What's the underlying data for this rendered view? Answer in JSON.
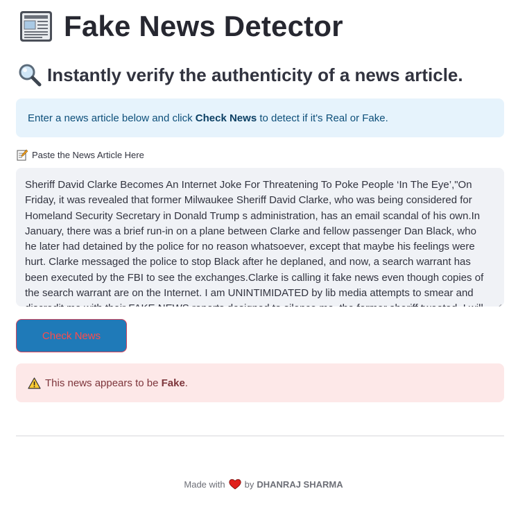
{
  "header": {
    "title": "Fake News Detector",
    "icon": "newspaper-icon"
  },
  "subheader": {
    "text": "Instantly verify the authenticity of a news article.",
    "icon": "magnifier-icon"
  },
  "info": {
    "prefix": "Enter a news article below and click ",
    "bold": "Check News",
    "suffix": " to detect if it's Real or Fake."
  },
  "input": {
    "label": "Paste the News Article Here",
    "icon": "memo-icon",
    "value": "Sheriff David Clarke Becomes An Internet Joke For Threatening To Poke People ‘In The Eye’,\"On Friday, it was revealed that former Milwaukee Sheriff David Clarke, who was being considered for Homeland Security Secretary in Donald Trump s administration, has an email scandal of his own.In January, there was a brief run-in on a plane between Clarke and fellow passenger Dan Black, who he later had detained by the police for no reason whatsoever, except that maybe his feelings were hurt. Clarke messaged the police to stop Black after he deplaned, and now, a search warrant has been executed by the FBI to see the exchanges.Clarke is calling it fake news even though copies of the search warrant are on the Internet. I am UNINTIMIDATED by lib media attempts to smear and discredit me with their FAKE NEWS reports designed to silence me,  the former sheriff tweeted.  I will"
  },
  "button": {
    "label": "Check News"
  },
  "result": {
    "icon": "warning-icon",
    "prefix": "This news appears to be ",
    "bold": "Fake",
    "suffix": ".",
    "color": "#fde8e8"
  },
  "footer": {
    "prefix": "Made with",
    "icon": "heart-icon",
    "by": "by",
    "author": "DHANRAJ SHARMA"
  },
  "colors": {
    "button_bg": "#1f7ab8",
    "button_text": "#ff4b4b",
    "info_bg": "#e6f3fc",
    "textarea_bg": "#f0f2f6"
  }
}
